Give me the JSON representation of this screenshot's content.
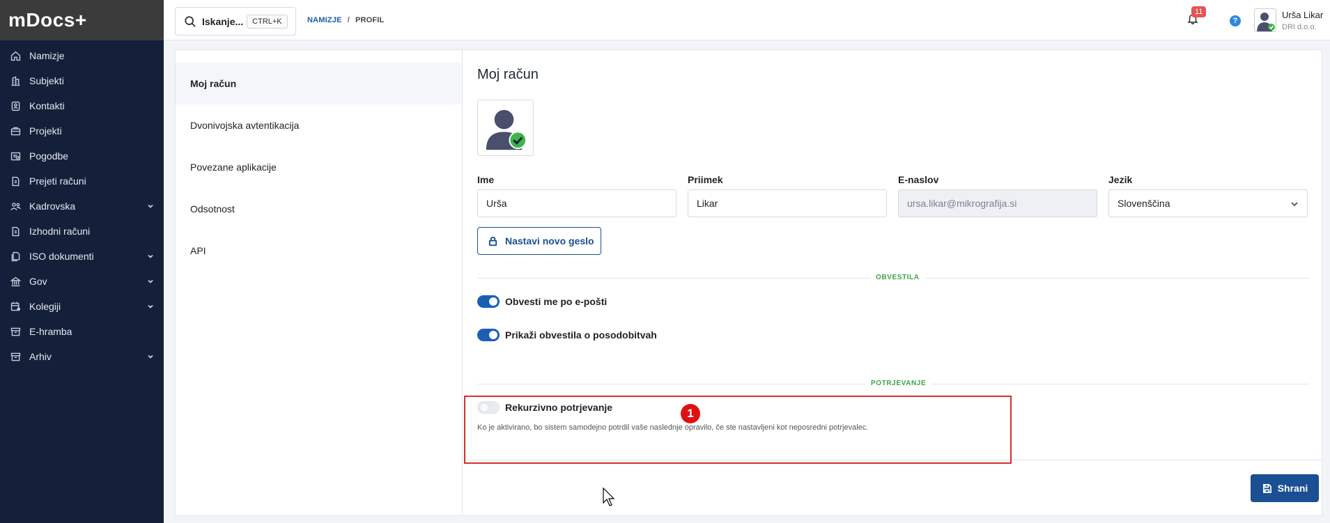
{
  "app": {
    "logo": "mDocs+"
  },
  "sidebar": {
    "items": [
      {
        "label": "Namizje",
        "icon": "home-icon",
        "chevron": false
      },
      {
        "label": "Subjekti",
        "icon": "building-icon",
        "chevron": false
      },
      {
        "label": "Kontakti",
        "icon": "contact-card-icon",
        "chevron": false
      },
      {
        "label": "Projekti",
        "icon": "briefcase-icon",
        "chevron": false
      },
      {
        "label": "Pogodbe",
        "icon": "contract-icon",
        "chevron": false
      },
      {
        "label": "Prejeti računi",
        "icon": "document-icon",
        "chevron": false
      },
      {
        "label": "Kadrovska",
        "icon": "people-icon",
        "chevron": true
      },
      {
        "label": "Izhodni računi",
        "icon": "document-icon",
        "chevron": false
      },
      {
        "label": "ISO dokumenti",
        "icon": "documents-icon",
        "chevron": true
      },
      {
        "label": "Gov",
        "icon": "bank-icon",
        "chevron": true
      },
      {
        "label": "Kolegiji",
        "icon": "calendar-people-icon",
        "chevron": true
      },
      {
        "label": "E-hramba",
        "icon": "archive-icon",
        "chevron": false
      },
      {
        "label": "Arhiv",
        "icon": "archive-icon",
        "chevron": true
      }
    ]
  },
  "topbar": {
    "search_label": "Iskanje...",
    "search_shortcut": "CTRL+K",
    "breadcrumb": {
      "link": "NAMIZJE",
      "separator": "/",
      "current": "PROFIL"
    },
    "notifications_count": "11",
    "help_label": "?",
    "user": {
      "name": "Urša Likar",
      "org": "DRI d.o.o."
    }
  },
  "settings_menu": {
    "items": [
      "Moj račun",
      "Dvonivojska avtentikacija",
      "Povezane aplikacije",
      "Odsotnost",
      "API"
    ],
    "active_index": 0
  },
  "profile": {
    "title": "Moj račun",
    "fields": {
      "first_name": {
        "label": "Ime",
        "value": "Urša"
      },
      "last_name": {
        "label": "Priimek",
        "value": "Likar"
      },
      "email": {
        "label": "E-naslov",
        "value": "ursa.likar@mikrografija.si"
      },
      "language": {
        "label": "Jezik",
        "value": "Slovenščina"
      }
    },
    "password_button": "Nastavi novo geslo",
    "notifications_section": "OBVESTILA",
    "toggles": {
      "email_notify": {
        "label": "Obvesti me po e-pošti",
        "on": true
      },
      "update_notify": {
        "label": "Prikaži obvestila o posodobitvah",
        "on": true
      }
    },
    "approval_section": "POTRJEVANJE",
    "recursive": {
      "label": "Rekurzivno potrjevanje",
      "on": false,
      "hint": "Ko je aktivirano, bo sistem samodejno potrdil vaše naslednje opravilo, če ste nastavljeni kot neposredni potrjevalec."
    },
    "save_button": "Shrani"
  },
  "annotation": {
    "marker": "1",
    "color": "#d32f2f"
  },
  "colors": {
    "sidebar_bg": "#14203a",
    "primary": "#1a4f93",
    "section_label": "#3ba54a"
  }
}
